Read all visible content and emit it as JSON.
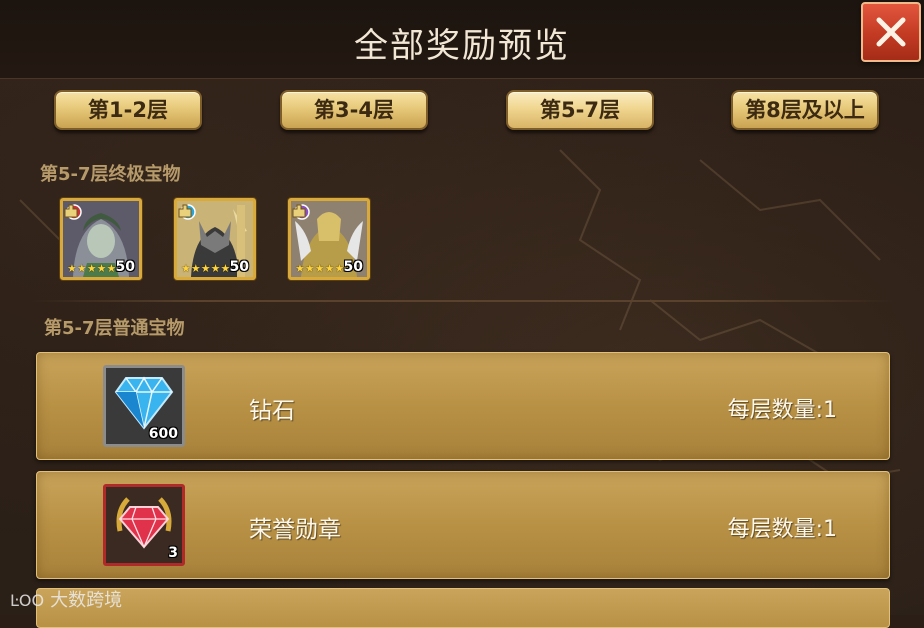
{
  "title": "全部奖励预览",
  "tabs": [
    {
      "label": "第1-2层",
      "active": false
    },
    {
      "label": "第3-4层",
      "active": false
    },
    {
      "label": "第5-7层",
      "active": true
    },
    {
      "label": "第8层及以上",
      "active": false
    }
  ],
  "ultimate_section": {
    "label": "第5-7层终极宝物",
    "heroes": [
      {
        "level": "50",
        "stars": 5,
        "faction_icon": "red-faction-icon",
        "faction_color": "#c8323a",
        "bg": "#6f6a7a"
      },
      {
        "level": "50",
        "stars": 5,
        "faction_icon": "blue-faction-icon",
        "faction_color": "#2aa6d8",
        "bg": "#c9b377"
      },
      {
        "level": "50",
        "stars": 5,
        "faction_icon": "purple-faction-icon",
        "faction_color": "#8a4fc0",
        "bg": "#9a8a6a"
      }
    ]
  },
  "normal_section": {
    "label": "第5-7层普通宝物",
    "items": [
      {
        "name": "钻石",
        "quantity": "600",
        "count_label": "每层数量:1",
        "icon": "diamond-icon"
      },
      {
        "name": "荣誉勋章",
        "quantity": "3",
        "count_label": "每层数量:1",
        "icon": "honor-medal-icon"
      }
    ]
  },
  "watermark": {
    "logo": "ĿOO",
    "text": "大数跨境"
  },
  "colors": {
    "accent_gold": "#d9a93a",
    "close_red": "#c33a23",
    "row_gold": "#b89145"
  }
}
